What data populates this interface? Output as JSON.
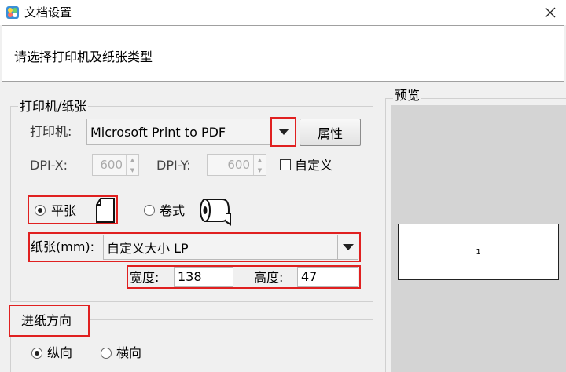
{
  "window": {
    "title": "文档设置",
    "icon": "app-logo-icon",
    "close_icon": "close-icon"
  },
  "header": {
    "text": "请选择打印机及纸张类型"
  },
  "printer_group": {
    "title": "打印机/纸张",
    "printer_label": "打印机:",
    "printer_value": "Microsoft Print to PDF",
    "properties_button": "属性",
    "dpi_x_label": "DPI-X:",
    "dpi_x_value": "600",
    "dpi_y_label": "DPI-Y:",
    "dpi_y_value": "600",
    "custom_label": "自定义",
    "custom_checked": false,
    "paper_mode": {
      "flat_label": "平张",
      "roll_label": "卷式",
      "selected": "平张"
    },
    "paper_label": "纸张(mm):",
    "paper_value": "自定义大小 LP",
    "width_label": "宽度:",
    "width_value": "138",
    "height_label": "高度:",
    "height_value": "47"
  },
  "feed_group": {
    "title": "进纸方向",
    "portrait_label": "纵向",
    "landscape_label": "横向",
    "selected": "纵向"
  },
  "preview": {
    "title": "预览",
    "page_number": "1"
  },
  "colors": {
    "highlight": "#e02020",
    "background": "#f0f0f0",
    "preview_bg": "#d4d4d4"
  }
}
